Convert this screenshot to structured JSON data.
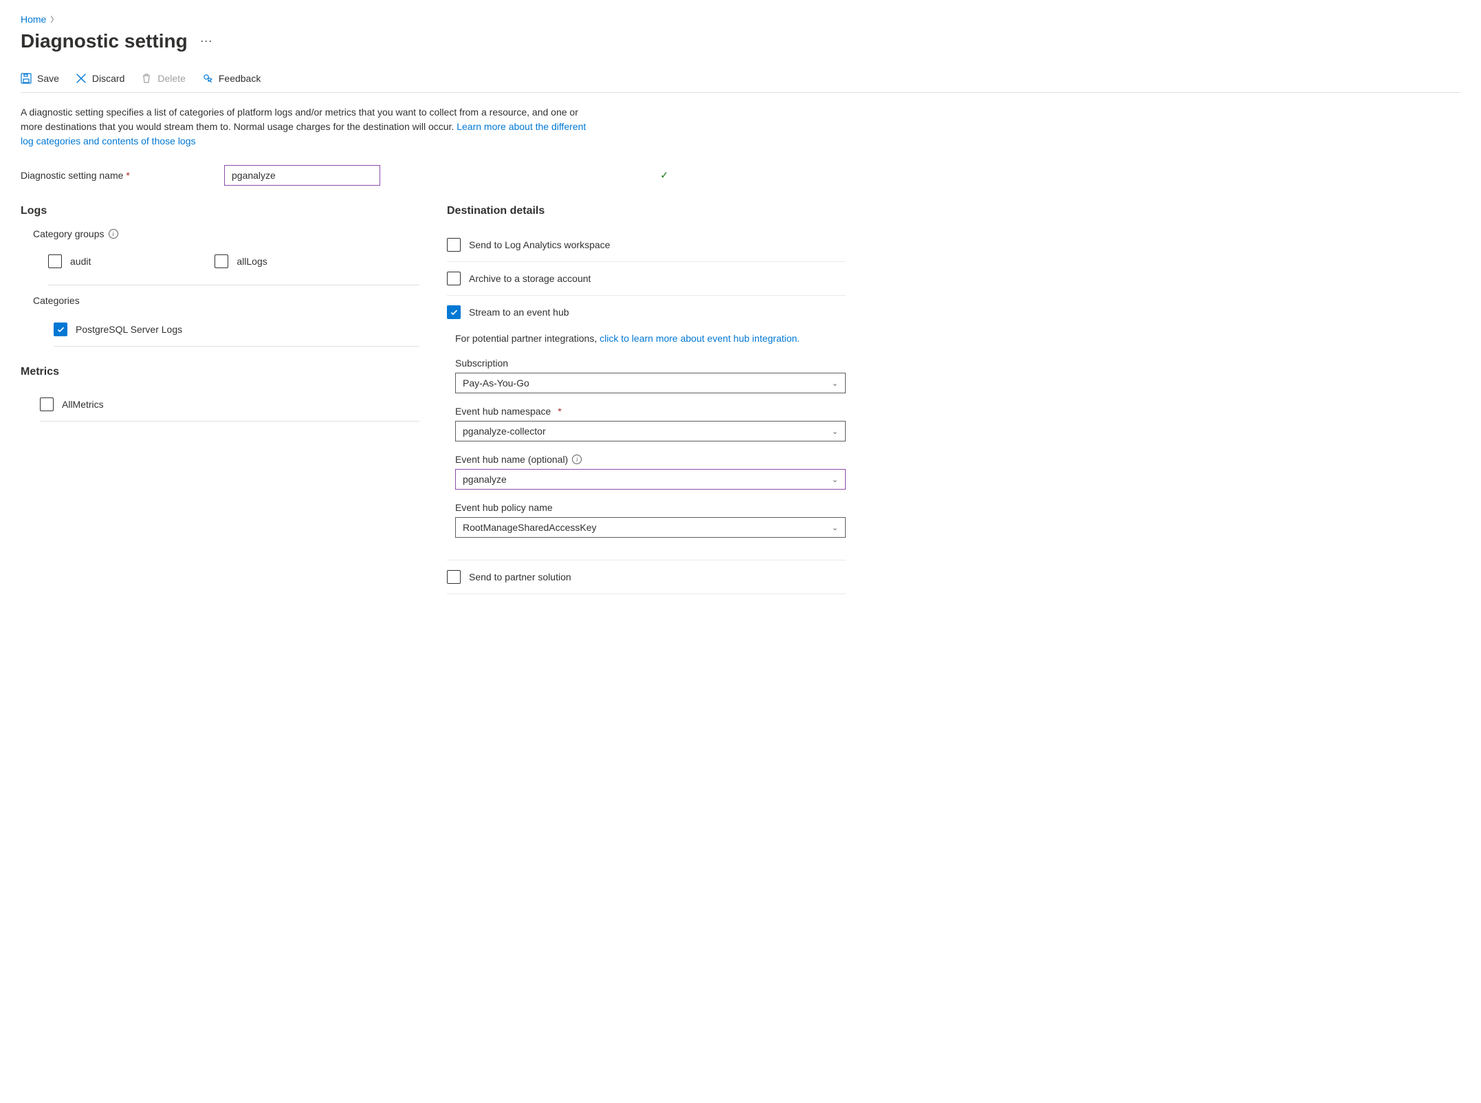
{
  "breadcrumb": {
    "home": "Home"
  },
  "page_title": "Diagnostic setting",
  "toolbar": {
    "save": "Save",
    "discard": "Discard",
    "delete": "Delete",
    "feedback": "Feedback"
  },
  "description": {
    "text1": "A diagnostic setting specifies a list of categories of platform logs and/or metrics that you want to collect from a resource, and one or more destinations that you would stream them to. Normal usage charges for the destination will occur. ",
    "link": "Learn more about the different log categories and contents of those logs"
  },
  "name_field": {
    "label": "Diagnostic setting name",
    "value": "pganalyze"
  },
  "logs": {
    "heading": "Logs",
    "category_groups_label": "Category groups",
    "groups": {
      "audit": "audit",
      "alllogs": "allLogs"
    },
    "categories_label": "Categories",
    "postgresql": "PostgreSQL Server Logs"
  },
  "metrics": {
    "heading": "Metrics",
    "allmetrics": "AllMetrics"
  },
  "dest": {
    "heading": "Destination details",
    "log_analytics": "Send to Log Analytics workspace",
    "storage": "Archive to a storage account",
    "eventhub": "Stream to an event hub",
    "partner": "Send to partner solution",
    "note_prefix": "For potential partner integrations, ",
    "note_link": "click to learn more about event hub integration.",
    "subscription": {
      "label": "Subscription",
      "value": "Pay-As-You-Go"
    },
    "namespace": {
      "label": "Event hub namespace",
      "value": "pganalyze-collector"
    },
    "hubname": {
      "label": "Event hub name (optional)",
      "value": "pganalyze"
    },
    "policy": {
      "label": "Event hub policy name",
      "value": "RootManageSharedAccessKey"
    }
  }
}
